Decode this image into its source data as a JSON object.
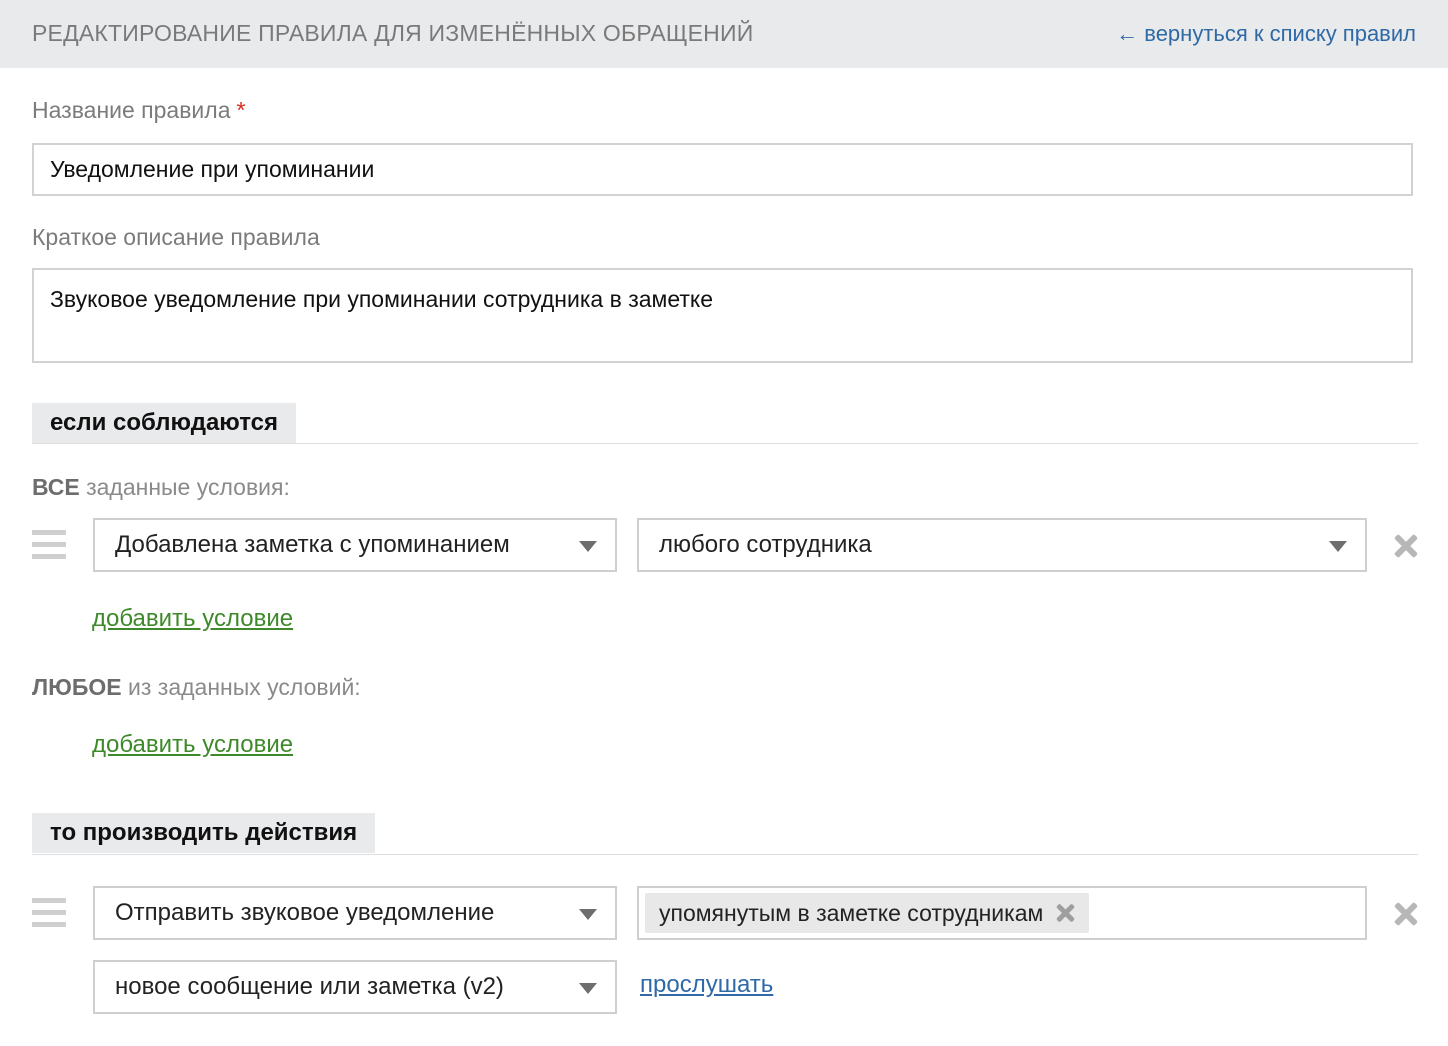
{
  "header": {
    "title": "РЕДАКТИРОВАНИЕ ПРАВИЛА ДЛЯ ИЗМЕНЁННЫХ ОБРАЩЕНИЙ",
    "back_link": "← вернуться к списку правил"
  },
  "form": {
    "name_label": "Название правила",
    "required_mark": "*",
    "name_value": "Уведомление при упоминании",
    "description_label": "Краткое описание правила",
    "description_value": "Звуковое уведомление при упоминании сотрудника в заметке"
  },
  "conditions": {
    "section_title": "если соблюдаются",
    "all_keyword": "ВСЕ",
    "all_suffix": " заданные условия:",
    "all_rows": [
      {
        "field": "Добавлена заметка с упоминанием",
        "value": "любого сотрудника"
      }
    ],
    "add_condition_all": "добавить условие",
    "any_keyword": "ЛЮБОЕ",
    "any_suffix": " из заданных условий:",
    "add_condition_any": "добавить условие"
  },
  "actions": {
    "section_title": "то производить действия",
    "rows": [
      {
        "action": "Отправить звуковое уведомление",
        "recipient_tag": "упомянутым в заметке сотрудникам",
        "sound": "новое сообщение или заметка (v2)",
        "listen_link": "прослушать"
      }
    ]
  },
  "icons": [
    "drag-handle-icon",
    "caret-down-icon",
    "remove-x-icon",
    "tag-remove-icon"
  ],
  "colors": {
    "header_bg": "#e9eaec",
    "link_blue": "#2f6aa6",
    "link_green": "#3e8a2b",
    "required_red": "#d9291c"
  }
}
